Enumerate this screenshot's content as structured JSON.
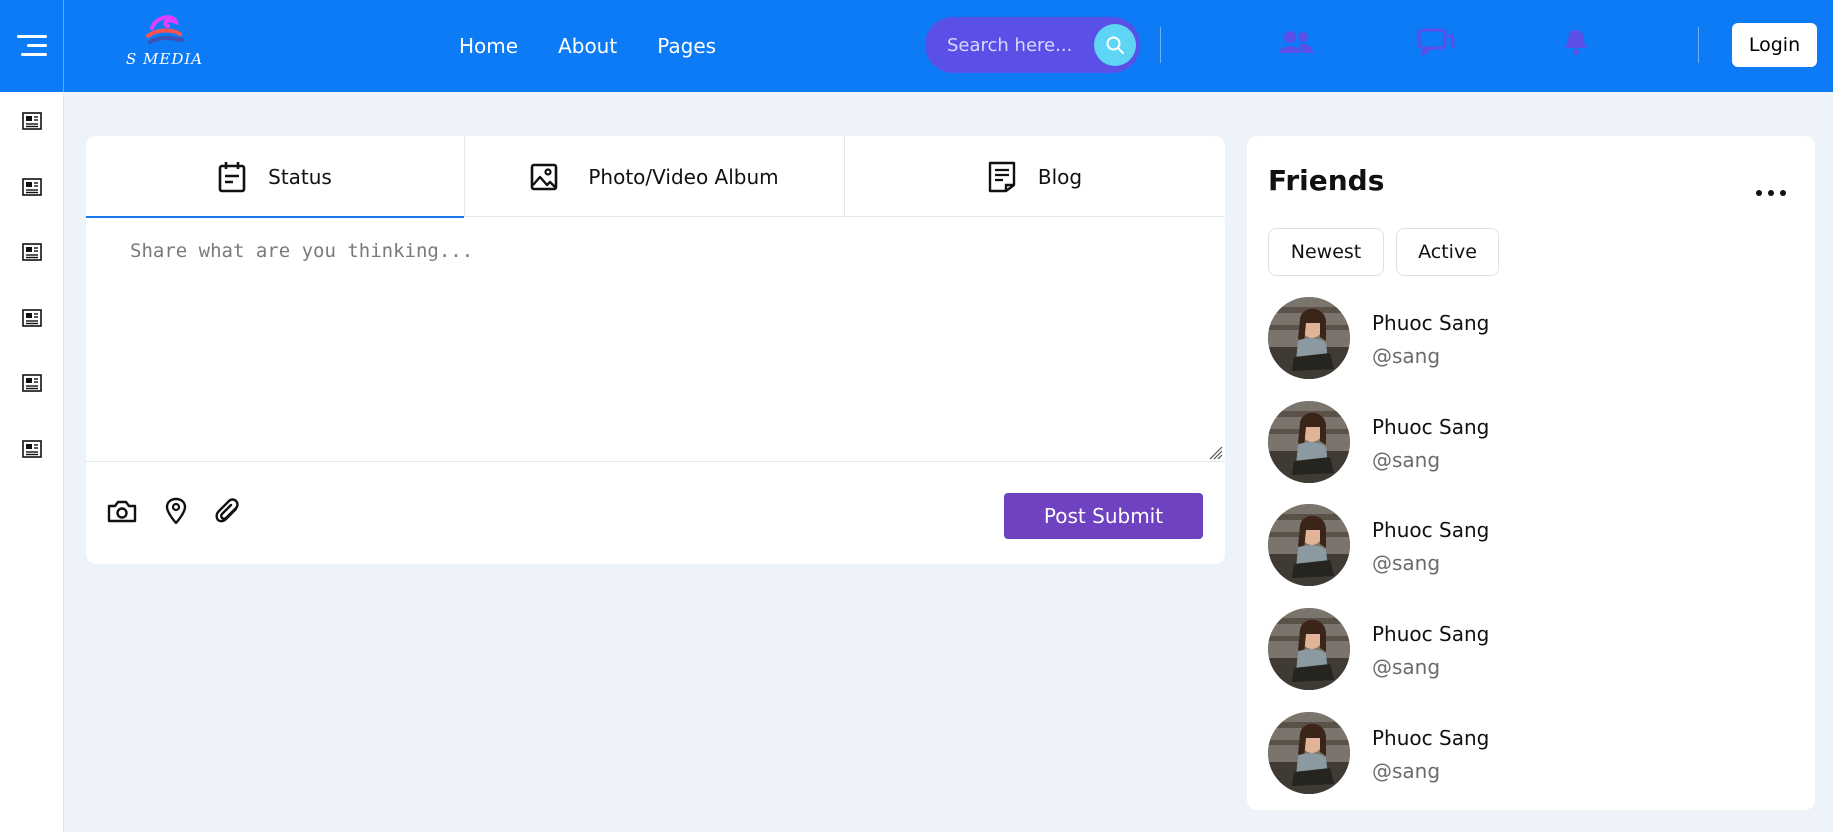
{
  "header": {
    "logo_text": "S MEDIA",
    "nav": [
      "Home",
      "About",
      "Pages"
    ],
    "search_placeholder": "Search here...",
    "login_label": "Login",
    "icons": [
      "friends-icon",
      "messages-icon",
      "bell-icon"
    ],
    "accent_color": "#0d7bf5"
  },
  "sidebar": {
    "icons": [
      "newspaper-icon",
      "newspaper-icon",
      "newspaper-icon",
      "newspaper-icon",
      "newspaper-icon",
      "newspaper-icon"
    ]
  },
  "composer": {
    "tabs": [
      {
        "label": "Status",
        "icon": "calendar-icon",
        "active": true
      },
      {
        "label": "Photo/Video Album",
        "icon": "image-icon",
        "active": false
      },
      {
        "label": "Blog",
        "icon": "document-icon",
        "active": false
      }
    ],
    "placeholder": "Share what are you thinking...",
    "tools": [
      "camera-icon",
      "location-pin-icon",
      "paperclip-icon"
    ],
    "submit_label": "Post Submit",
    "submit_color": "#6f42c1"
  },
  "friends": {
    "title": "Friends",
    "filters": [
      "Newest",
      "Active"
    ],
    "list": [
      {
        "name": "Phuoc Sang",
        "handle": "@sang"
      },
      {
        "name": "Phuoc Sang",
        "handle": "@sang"
      },
      {
        "name": "Phuoc Sang",
        "handle": "@sang"
      },
      {
        "name": "Phuoc Sang",
        "handle": "@sang"
      },
      {
        "name": "Phuoc Sang",
        "handle": "@sang"
      }
    ]
  }
}
